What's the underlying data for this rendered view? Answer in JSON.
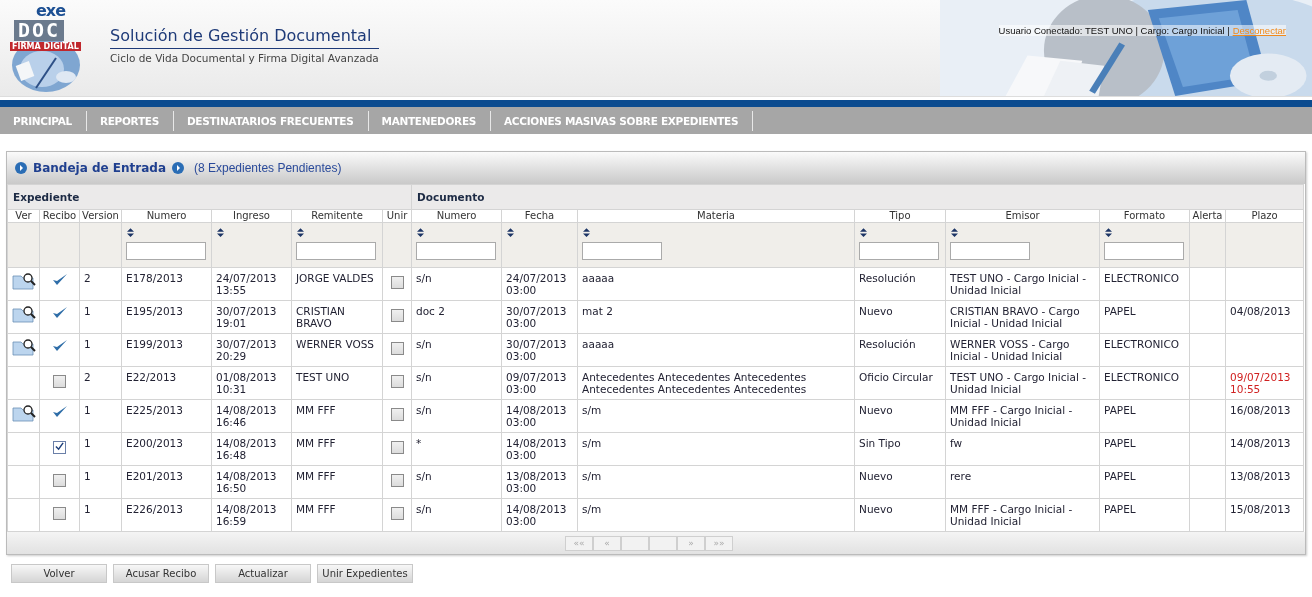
{
  "header": {
    "logo": {
      "top": "exe",
      "main": "DOC",
      "tag": "FIRMA DIGITAL"
    },
    "title": "Solución de Gestión Documental",
    "subtitle": "Ciclo de Vida Documental y Firma Digital Avanzada",
    "user_info": "Usuario Conectado: TEST UNO | Cargo: Cargo Inicial |",
    "logout": "Desconectar"
  },
  "nav": [
    "PRINCIPAL",
    "REPORTES",
    "DESTINATARIOS FRECUENTES",
    "MANTENEDORES",
    "ACCIONES MASIVAS SOBRE EXPEDIENTES"
  ],
  "panel": {
    "title": "Bandeja de Entrada",
    "count": "(8 Expedientes Pendientes)"
  },
  "groups": [
    {
      "label": "Expediente"
    },
    {
      "label": "Documento"
    }
  ],
  "columns": [
    {
      "label": "Ver",
      "sortable": false,
      "filter": false
    },
    {
      "label": "Recibo",
      "sortable": false,
      "filter": false
    },
    {
      "label": "Version",
      "sortable": false,
      "filter": false
    },
    {
      "label": "Numero",
      "sortable": true,
      "filter": true
    },
    {
      "label": "Ingreso",
      "sortable": true,
      "filter": false
    },
    {
      "label": "Remitente",
      "sortable": true,
      "filter": true
    },
    {
      "label": "Unir",
      "sortable": false,
      "filter": false
    },
    {
      "label": "Numero",
      "sortable": true,
      "filter": true
    },
    {
      "label": "Fecha",
      "sortable": true,
      "filter": false
    },
    {
      "label": "Materia",
      "sortable": true,
      "filter": true
    },
    {
      "label": "Tipo",
      "sortable": true,
      "filter": true
    },
    {
      "label": "Emisor",
      "sortable": true,
      "filter": true
    },
    {
      "label": "Formato",
      "sortable": true,
      "filter": true
    },
    {
      "label": "Alerta",
      "sortable": false,
      "filter": false
    },
    {
      "label": "Plazo",
      "sortable": false,
      "filter": false
    }
  ],
  "rows": [
    {
      "folder": true,
      "recibo": {
        "kind": "acknowledged"
      },
      "version": "2",
      "numero": "E178/2013",
      "ingreso": "24/07/2013 13:55",
      "remitente": "JORGE VALDES",
      "unir": false,
      "doc_numero": "s/n",
      "fecha": "24/07/2013 03:00",
      "materia": "aaaaa",
      "tipo": "Resolución",
      "emisor": "TEST UNO - Cargo Inicial - Unidad Inicial",
      "formato": "ELECTRONICO"
    },
    {
      "folder": true,
      "recibo": {
        "kind": "acknowledged"
      },
      "version": "1",
      "numero": "E195/2013",
      "ingreso": "30/07/2013 19:01",
      "remitente": "CRISTIAN BRAVO",
      "unir": false,
      "doc_numero": "doc 2",
      "fecha": "30/07/2013 03:00",
      "materia": "mat 2",
      "tipo": "Nuevo",
      "emisor": "CRISTIAN BRAVO - Cargo Inicial - Unidad Inicial",
      "formato": "PAPEL",
      "plazo": "04/08/2013",
      "overdue": false
    },
    {
      "folder": true,
      "recibo": {
        "kind": "acknowledged"
      },
      "version": "1",
      "numero": "E199/2013",
      "ingreso": "30/07/2013 20:29",
      "remitente": "WERNER VOSS",
      "unir": false,
      "doc_numero": "s/n",
      "fecha": "30/07/2013 03:00",
      "materia": "aaaaa",
      "tipo": "Resolución",
      "emisor": "WERNER VOSS - Cargo Inicial - Unidad Inicial",
      "formato": "ELECTRONICO"
    },
    {
      "folder": false,
      "recibo": {
        "kind": "checkbox",
        "checked": false
      },
      "version": "2",
      "numero": "E22/2013",
      "ingreso": "01/08/2013 10:31",
      "remitente": "TEST UNO",
      "unir": false,
      "doc_numero": "s/n",
      "fecha": "09/07/2013 03:00",
      "materia": "Antecedentes Antecedentes Antecedentes Antecedentes Antecedentes Antecedentes",
      "tipo": "Oficio Circular",
      "emisor": "TEST UNO - Cargo Inicial - Unidad Inicial",
      "formato": "ELECTRONICO",
      "plazo": "09/07/2013 10:55",
      "overdue": true
    },
    {
      "folder": true,
      "recibo": {
        "kind": "acknowledged"
      },
      "version": "1",
      "numero": "E225/2013",
      "ingreso": "14/08/2013 16:46",
      "remitente": "MM FFF",
      "unir": false,
      "doc_numero": "s/n",
      "fecha": "14/08/2013 03:00",
      "materia": "s/m",
      "tipo": "Nuevo",
      "emisor": "MM FFF - Cargo Inicial - Unidad Inicial",
      "formato": "PAPEL",
      "plazo": "16/08/2013",
      "overdue": false
    },
    {
      "folder": false,
      "recibo": {
        "kind": "checkbox",
        "checked": true
      },
      "version": "1",
      "numero": "E200/2013",
      "ingreso": "14/08/2013 16:48",
      "remitente": "MM FFF",
      "unir": false,
      "doc_numero": "*",
      "fecha": "14/08/2013 03:00",
      "materia": "s/m",
      "tipo": "Sin Tipo",
      "emisor": "fw",
      "formato": "PAPEL",
      "plazo": "14/08/2013",
      "overdue": false
    },
    {
      "folder": false,
      "recibo": {
        "kind": "checkbox",
        "checked": false
      },
      "version": "1",
      "numero": "E201/2013",
      "ingreso": "14/08/2013 16:50",
      "remitente": "MM FFF",
      "unir": false,
      "doc_numero": "s/n",
      "fecha": "13/08/2013 03:00",
      "materia": "s/m",
      "tipo": "Nuevo",
      "emisor": "rere",
      "formato": "PAPEL",
      "plazo": "13/08/2013",
      "overdue": false
    },
    {
      "folder": false,
      "recibo": {
        "kind": "checkbox",
        "checked": false
      },
      "version": "1",
      "numero": "E226/2013",
      "ingreso": "14/08/2013 16:59",
      "remitente": "MM FFF",
      "unir": false,
      "doc_numero": "s/n",
      "fecha": "14/08/2013 03:00",
      "materia": "s/m",
      "tipo": "Nuevo",
      "emisor": "MM FFF - Cargo Inicial - Unidad Inicial",
      "formato": "PAPEL",
      "plazo": "15/08/2013",
      "overdue": false
    }
  ],
  "pager": {
    "first": "««",
    "prev": "«",
    "next": "»",
    "last": "»»"
  },
  "buttons": [
    "Volver",
    "Acusar Recibo",
    "Actualizar",
    "Unir Expedientes"
  ]
}
